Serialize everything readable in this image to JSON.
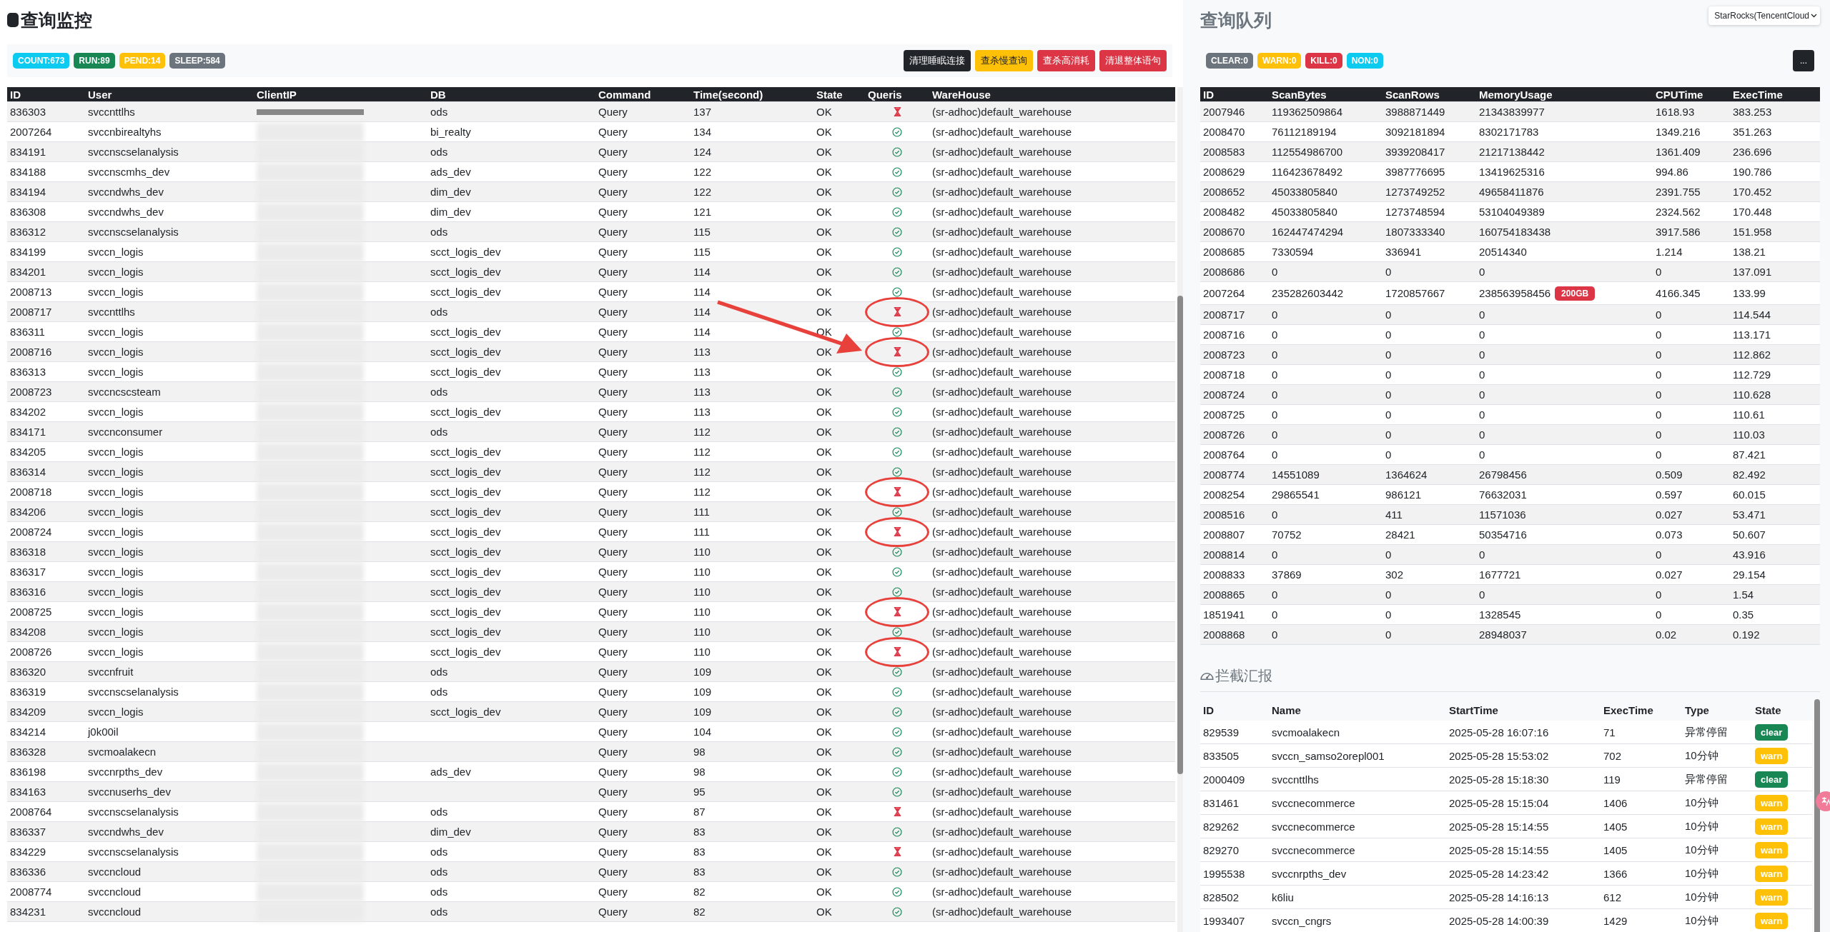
{
  "monitor": {
    "title": "查询监控",
    "stats": [
      {
        "label": "COUNT:673",
        "color": "#0dcaf0"
      },
      {
        "label": "RUN:89",
        "color": "#198754"
      },
      {
        "label": "PEND:14",
        "color": "#ffc107"
      },
      {
        "label": "SLEEP:584",
        "color": "#6c757d"
      }
    ],
    "actions": [
      {
        "label": "清理睡眠连接",
        "kind": "dark"
      },
      {
        "label": "查杀慢查询",
        "kind": "warning"
      },
      {
        "label": "查杀高消耗",
        "kind": "danger"
      },
      {
        "label": "清退整体语句",
        "kind": "danger"
      }
    ],
    "table": {
      "columns": [
        "ID",
        "User",
        "ClientIP",
        "DB",
        "Command",
        "Time(second)",
        "State",
        "Queris",
        "WareHouse"
      ],
      "rows": [
        {
          "id": "836303",
          "user": "svccnttlhs",
          "db": "ods",
          "command": "Query",
          "time": "137",
          "state": "OK",
          "kind": "waiting",
          "circled": false,
          "warehouse": "(sr-adhoc)default_warehouse"
        },
        {
          "id": "2007264",
          "user": "svccnbirealtyhs",
          "db": "bi_realty",
          "command": "Query",
          "time": "134",
          "state": "OK",
          "kind": "done",
          "circled": false,
          "warehouse": "(sr-adhoc)default_warehouse"
        },
        {
          "id": "834191",
          "user": "svccnscselanalysis",
          "db": "ods",
          "command": "Query",
          "time": "124",
          "state": "OK",
          "kind": "done",
          "circled": false,
          "warehouse": "(sr-adhoc)default_warehouse"
        },
        {
          "id": "834188",
          "user": "svccnscmhs_dev",
          "db": "ads_dev",
          "command": "Query",
          "time": "122",
          "state": "OK",
          "kind": "done",
          "circled": false,
          "warehouse": "(sr-adhoc)default_warehouse"
        },
        {
          "id": "834194",
          "user": "svccndwhs_dev",
          "db": "dim_dev",
          "command": "Query",
          "time": "122",
          "state": "OK",
          "kind": "done",
          "circled": false,
          "warehouse": "(sr-adhoc)default_warehouse"
        },
        {
          "id": "836308",
          "user": "svccndwhs_dev",
          "db": "dim_dev",
          "command": "Query",
          "time": "121",
          "state": "OK",
          "kind": "done",
          "circled": false,
          "warehouse": "(sr-adhoc)default_warehouse"
        },
        {
          "id": "836312",
          "user": "svccnscselanalysis",
          "db": "ods",
          "command": "Query",
          "time": "115",
          "state": "OK",
          "kind": "done",
          "circled": false,
          "warehouse": "(sr-adhoc)default_warehouse"
        },
        {
          "id": "834199",
          "user": "svccn_logis",
          "db": "scct_logis_dev",
          "command": "Query",
          "time": "115",
          "state": "OK",
          "kind": "done",
          "circled": false,
          "warehouse": "(sr-adhoc)default_warehouse"
        },
        {
          "id": "834201",
          "user": "svccn_logis",
          "db": "scct_logis_dev",
          "command": "Query",
          "time": "114",
          "state": "OK",
          "kind": "done",
          "circled": false,
          "warehouse": "(sr-adhoc)default_warehouse"
        },
        {
          "id": "2008713",
          "user": "svccn_logis",
          "db": "scct_logis_dev",
          "command": "Query",
          "time": "114",
          "state": "OK",
          "kind": "done",
          "circled": false,
          "warehouse": "(sr-adhoc)default_warehouse"
        },
        {
          "id": "2008717",
          "user": "svccnttlhs",
          "db": "ods",
          "command": "Query",
          "time": "114",
          "state": "OK",
          "kind": "waiting",
          "circled": true,
          "warehouse": "(sr-adhoc)default_warehouse"
        },
        {
          "id": "836311",
          "user": "svccn_logis",
          "db": "scct_logis_dev",
          "command": "Query",
          "time": "114",
          "state": "OK",
          "kind": "done",
          "circled": false,
          "warehouse": "(sr-adhoc)default_warehouse"
        },
        {
          "id": "2008716",
          "user": "svccn_logis",
          "db": "scct_logis_dev",
          "command": "Query",
          "time": "113",
          "state": "OK",
          "kind": "waiting",
          "circled": true,
          "warehouse": "(sr-adhoc)default_warehouse"
        },
        {
          "id": "836313",
          "user": "svccn_logis",
          "db": "scct_logis_dev",
          "command": "Query",
          "time": "113",
          "state": "OK",
          "kind": "done",
          "circled": false,
          "warehouse": "(sr-adhoc)default_warehouse"
        },
        {
          "id": "2008723",
          "user": "svccncscsteam",
          "db": "ods",
          "command": "Query",
          "time": "113",
          "state": "OK",
          "kind": "done",
          "circled": false,
          "warehouse": "(sr-adhoc)default_warehouse"
        },
        {
          "id": "834202",
          "user": "svccn_logis",
          "db": "scct_logis_dev",
          "command": "Query",
          "time": "113",
          "state": "OK",
          "kind": "done",
          "circled": false,
          "warehouse": "(sr-adhoc)default_warehouse"
        },
        {
          "id": "834171",
          "user": "svccnconsumer",
          "db": "ods",
          "command": "Query",
          "time": "112",
          "state": "OK",
          "kind": "done",
          "circled": false,
          "warehouse": "(sr-adhoc)default_warehouse"
        },
        {
          "id": "834205",
          "user": "svccn_logis",
          "db": "scct_logis_dev",
          "command": "Query",
          "time": "112",
          "state": "OK",
          "kind": "done",
          "circled": false,
          "warehouse": "(sr-adhoc)default_warehouse"
        },
        {
          "id": "836314",
          "user": "svccn_logis",
          "db": "scct_logis_dev",
          "command": "Query",
          "time": "112",
          "state": "OK",
          "kind": "done",
          "circled": false,
          "warehouse": "(sr-adhoc)default_warehouse"
        },
        {
          "id": "2008718",
          "user": "svccn_logis",
          "db": "scct_logis_dev",
          "command": "Query",
          "time": "112",
          "state": "OK",
          "kind": "waiting",
          "circled": true,
          "warehouse": "(sr-adhoc)default_warehouse"
        },
        {
          "id": "834206",
          "user": "svccn_logis",
          "db": "scct_logis_dev",
          "command": "Query",
          "time": "111",
          "state": "OK",
          "kind": "done",
          "circled": false,
          "warehouse": "(sr-adhoc)default_warehouse"
        },
        {
          "id": "2008724",
          "user": "svccn_logis",
          "db": "scct_logis_dev",
          "command": "Query",
          "time": "111",
          "state": "OK",
          "kind": "waiting",
          "circled": true,
          "warehouse": "(sr-adhoc)default_warehouse"
        },
        {
          "id": "836318",
          "user": "svccn_logis",
          "db": "scct_logis_dev",
          "command": "Query",
          "time": "110",
          "state": "OK",
          "kind": "done",
          "circled": false,
          "warehouse": "(sr-adhoc)default_warehouse"
        },
        {
          "id": "836317",
          "user": "svccn_logis",
          "db": "scct_logis_dev",
          "command": "Query",
          "time": "110",
          "state": "OK",
          "kind": "done",
          "circled": false,
          "warehouse": "(sr-adhoc)default_warehouse"
        },
        {
          "id": "836316",
          "user": "svccn_logis",
          "db": "scct_logis_dev",
          "command": "Query",
          "time": "110",
          "state": "OK",
          "kind": "done",
          "circled": false,
          "warehouse": "(sr-adhoc)default_warehouse"
        },
        {
          "id": "2008725",
          "user": "svccn_logis",
          "db": "scct_logis_dev",
          "command": "Query",
          "time": "110",
          "state": "OK",
          "kind": "waiting",
          "circled": true,
          "warehouse": "(sr-adhoc)default_warehouse"
        },
        {
          "id": "834208",
          "user": "svccn_logis",
          "db": "scct_logis_dev",
          "command": "Query",
          "time": "110",
          "state": "OK",
          "kind": "done",
          "circled": false,
          "warehouse": "(sr-adhoc)default_warehouse"
        },
        {
          "id": "2008726",
          "user": "svccn_logis",
          "db": "scct_logis_dev",
          "command": "Query",
          "time": "110",
          "state": "OK",
          "kind": "waiting",
          "circled": true,
          "warehouse": "(sr-adhoc)default_warehouse"
        },
        {
          "id": "836320",
          "user": "svccnfruit",
          "db": "ods",
          "command": "Query",
          "time": "109",
          "state": "OK",
          "kind": "done",
          "circled": false,
          "warehouse": "(sr-adhoc)default_warehouse"
        },
        {
          "id": "836319",
          "user": "svccnscselanalysis",
          "db": "ods",
          "command": "Query",
          "time": "109",
          "state": "OK",
          "kind": "done",
          "circled": false,
          "warehouse": "(sr-adhoc)default_warehouse"
        },
        {
          "id": "834209",
          "user": "svccn_logis",
          "db": "scct_logis_dev",
          "command": "Query",
          "time": "109",
          "state": "OK",
          "kind": "done",
          "circled": false,
          "warehouse": "(sr-adhoc)default_warehouse"
        },
        {
          "id": "834214",
          "user": "j0k00il",
          "command": "Query",
          "time": "104",
          "state": "OK",
          "kind": "done",
          "circled": false,
          "warehouse": "(sr-adhoc)default_warehouse"
        },
        {
          "id": "836328",
          "user": "svcmoalakecn",
          "command": "Query",
          "time": "98",
          "state": "OK",
          "kind": "done",
          "circled": false,
          "warehouse": "(sr-adhoc)default_warehouse"
        },
        {
          "id": "836198",
          "user": "svccnrpths_dev",
          "db": "ads_dev",
          "command": "Query",
          "time": "98",
          "state": "OK",
          "kind": "done",
          "circled": false,
          "warehouse": "(sr-adhoc)default_warehouse"
        },
        {
          "id": "834163",
          "user": "svccnuserhs_dev",
          "command": "Query",
          "time": "95",
          "state": "OK",
          "kind": "done",
          "circled": false,
          "warehouse": "(sr-adhoc)default_warehouse"
        },
        {
          "id": "2008764",
          "user": "svccnscselanalysis",
          "db": "ods",
          "command": "Query",
          "time": "87",
          "state": "OK",
          "kind": "waiting",
          "circled": false,
          "warehouse": "(sr-adhoc)default_warehouse"
        },
        {
          "id": "836337",
          "user": "svccndwhs_dev",
          "db": "dim_dev",
          "command": "Query",
          "time": "83",
          "state": "OK",
          "kind": "done",
          "circled": false,
          "warehouse": "(sr-adhoc)default_warehouse"
        },
        {
          "id": "834229",
          "user": "svccnscselanalysis",
          "db": "ods",
          "command": "Query",
          "time": "83",
          "state": "OK",
          "kind": "waiting",
          "circled": false,
          "warehouse": "(sr-adhoc)default_warehouse"
        },
        {
          "id": "836336",
          "user": "svccncloud",
          "db": "ods",
          "command": "Query",
          "time": "83",
          "state": "OK",
          "kind": "done",
          "circled": false,
          "warehouse": "(sr-adhoc)default_warehouse"
        },
        {
          "id": "2008774",
          "user": "svccncloud",
          "db": "ods",
          "command": "Query",
          "time": "82",
          "state": "OK",
          "kind": "done",
          "circled": false,
          "warehouse": "(sr-adhoc)default_warehouse"
        },
        {
          "id": "834231",
          "user": "svccncloud",
          "db": "ods",
          "command": "Query",
          "time": "82",
          "state": "OK",
          "kind": "done",
          "circled": false,
          "warehouse": "(sr-adhoc)default_warehouse"
        }
      ]
    }
  },
  "queue": {
    "title": "查询队列",
    "cluster_select": {
      "value": "StarRocks(TencentCloud"
    },
    "counters": [
      {
        "label": "CLEAR:0",
        "color": "#6c757d"
      },
      {
        "label": "WARN:0",
        "color": "#ffc107"
      },
      {
        "label": "KILL:0",
        "color": "#dc3545"
      },
      {
        "label": "NON:0",
        "color": "#0dcaf0"
      }
    ],
    "more_button": "...",
    "table": {
      "columns": [
        "ID",
        "ScanBytes",
        "ScanRows",
        "MemoryUsage",
        "CPUTime",
        "ExecTime"
      ],
      "rows": [
        {
          "id": "2007946",
          "scan_bytes": "119362509864",
          "scan_rows": "3988871449",
          "memory": "21343839977",
          "cpu": "1618.93",
          "exec": "383.253"
        },
        {
          "id": "2008470",
          "scan_bytes": "76112189194",
          "scan_rows": "3092181894",
          "memory": "8302171783",
          "cpu": "1349.216",
          "exec": "351.263"
        },
        {
          "id": "2008583",
          "scan_bytes": "112554986700",
          "scan_rows": "3939208417",
          "memory": "21217138442",
          "cpu": "1361.409",
          "exec": "236.696"
        },
        {
          "id": "2008629",
          "scan_bytes": "116423678492",
          "scan_rows": "3987776695",
          "memory": "13419625316",
          "cpu": "994.86",
          "exec": "190.786"
        },
        {
          "id": "2008652",
          "scan_bytes": "45033805840",
          "scan_rows": "1273749252",
          "memory": "49658411876",
          "cpu": "2391.755",
          "exec": "170.452"
        },
        {
          "id": "2008482",
          "scan_bytes": "45033805840",
          "scan_rows": "1273748594",
          "memory": "53104049389",
          "cpu": "2324.562",
          "exec": "170.448"
        },
        {
          "id": "2008670",
          "scan_bytes": "162447474294",
          "scan_rows": "1807333340",
          "memory": "160754183438",
          "cpu": "3917.586",
          "exec": "151.958"
        },
        {
          "id": "2008685",
          "scan_bytes": "7330594",
          "scan_rows": "336941",
          "memory": "20514340",
          "cpu": "1.214",
          "exec": "138.21"
        },
        {
          "id": "2008686",
          "scan_bytes": "0",
          "scan_rows": "0",
          "memory": "0",
          "cpu": "0",
          "exec": "137.091"
        },
        {
          "id": "2007264",
          "scan_bytes": "235282603442",
          "scan_rows": "1720857667",
          "memory": "238563958456",
          "memory_tag": "200GB",
          "cpu": "4166.345",
          "exec": "133.99"
        },
        {
          "id": "2008717",
          "scan_bytes": "0",
          "scan_rows": "0",
          "memory": "0",
          "cpu": "0",
          "exec": "114.544"
        },
        {
          "id": "2008716",
          "scan_bytes": "0",
          "scan_rows": "0",
          "memory": "0",
          "cpu": "0",
          "exec": "113.171"
        },
        {
          "id": "2008723",
          "scan_bytes": "0",
          "scan_rows": "0",
          "memory": "0",
          "cpu": "0",
          "exec": "112.862"
        },
        {
          "id": "2008718",
          "scan_bytes": "0",
          "scan_rows": "0",
          "memory": "0",
          "cpu": "0",
          "exec": "112.729"
        },
        {
          "id": "2008724",
          "scan_bytes": "0",
          "scan_rows": "0",
          "memory": "0",
          "cpu": "0",
          "exec": "110.628"
        },
        {
          "id": "2008725",
          "scan_bytes": "0",
          "scan_rows": "0",
          "memory": "0",
          "cpu": "0",
          "exec": "110.61"
        },
        {
          "id": "2008726",
          "scan_bytes": "0",
          "scan_rows": "0",
          "memory": "0",
          "cpu": "0",
          "exec": "110.03"
        },
        {
          "id": "2008764",
          "scan_bytes": "0",
          "scan_rows": "0",
          "memory": "0",
          "cpu": "0",
          "exec": "87.421"
        },
        {
          "id": "2008774",
          "scan_bytes": "14551089",
          "scan_rows": "1364624",
          "memory": "26798456",
          "cpu": "0.509",
          "exec": "82.492"
        },
        {
          "id": "2008254",
          "scan_bytes": "29865541",
          "scan_rows": "986121",
          "memory": "76632031",
          "cpu": "0.597",
          "exec": "60.015"
        },
        {
          "id": "2008516",
          "scan_bytes": "0",
          "scan_rows": "411",
          "memory": "11571036",
          "cpu": "0.027",
          "exec": "53.471"
        },
        {
          "id": "2008807",
          "scan_bytes": "70752",
          "scan_rows": "28421",
          "memory": "50354716",
          "cpu": "0.073",
          "exec": "50.607"
        },
        {
          "id": "2008814",
          "scan_bytes": "0",
          "scan_rows": "0",
          "memory": "0",
          "cpu": "0",
          "exec": "43.916"
        },
        {
          "id": "2008833",
          "scan_bytes": "37869",
          "scan_rows": "302",
          "memory": "1677721",
          "cpu": "0.027",
          "exec": "29.154"
        },
        {
          "id": "2008865",
          "scan_bytes": "0",
          "scan_rows": "0",
          "memory": "0",
          "cpu": "0",
          "exec": "1.54"
        },
        {
          "id": "1851941",
          "scan_bytes": "0",
          "scan_rows": "0",
          "memory": "1328545",
          "cpu": "0",
          "exec": "0.35"
        },
        {
          "id": "2008868",
          "scan_bytes": "0",
          "scan_rows": "0",
          "memory": "28948037",
          "cpu": "0.02",
          "exec": "0.192"
        }
      ]
    }
  },
  "intercept": {
    "title": "拦截汇报",
    "table": {
      "columns": [
        "ID",
        "Name",
        "StartTime",
        "ExecTime",
        "Type",
        "State"
      ],
      "rows": [
        {
          "id": "829539",
          "name": "svcmoalakecn",
          "start_time": "2025-05-28 16:07:16",
          "exec_time": "71",
          "type": "异常停留",
          "state": {
            "label": "clear",
            "color": "#198754"
          }
        },
        {
          "id": "833505",
          "name": "svccn_samso2orepl001",
          "start_time": "2025-05-28 15:53:02",
          "exec_time": "702",
          "type": "10分钟",
          "state": {
            "label": "warn",
            "color": "#ffc107"
          }
        },
        {
          "id": "2000409",
          "name": "svccnttlhs",
          "start_time": "2025-05-28 15:18:30",
          "exec_time": "119",
          "type": "异常停留",
          "state": {
            "label": "clear",
            "color": "#198754"
          }
        },
        {
          "id": "831461",
          "name": "svccnecommerce",
          "start_time": "2025-05-28 15:15:04",
          "exec_time": "1406",
          "type": "10分钟",
          "state": {
            "label": "warn",
            "color": "#ffc107"
          }
        },
        {
          "id": "829262",
          "name": "svccnecommerce",
          "start_time": "2025-05-28 15:14:55",
          "exec_time": "1405",
          "type": "10分钟",
          "state": {
            "label": "warn",
            "color": "#ffc107"
          }
        },
        {
          "id": "829270",
          "name": "svccnecommerce",
          "start_time": "2025-05-28 15:14:55",
          "exec_time": "1405",
          "type": "10分钟",
          "state": {
            "label": "warn",
            "color": "#ffc107"
          }
        },
        {
          "id": "1995538",
          "name": "svccnrpths_dev",
          "start_time": "2025-05-28 14:23:42",
          "exec_time": "1366",
          "type": "10分钟",
          "state": {
            "label": "warn",
            "color": "#ffc107"
          }
        },
        {
          "id": "828502",
          "name": "k6liu",
          "start_time": "2025-05-28 14:16:13",
          "exec_time": "612",
          "type": "10分钟",
          "state": {
            "label": "warn",
            "color": "#ffc107"
          }
        },
        {
          "id": "1993407",
          "name": "svccn_cngrs",
          "start_time": "2025-05-28 14:00:39",
          "exec_time": "1429",
          "type": "10分钟",
          "state": {
            "label": "warn",
            "color": "#ffc107"
          }
        }
      ]
    }
  }
}
